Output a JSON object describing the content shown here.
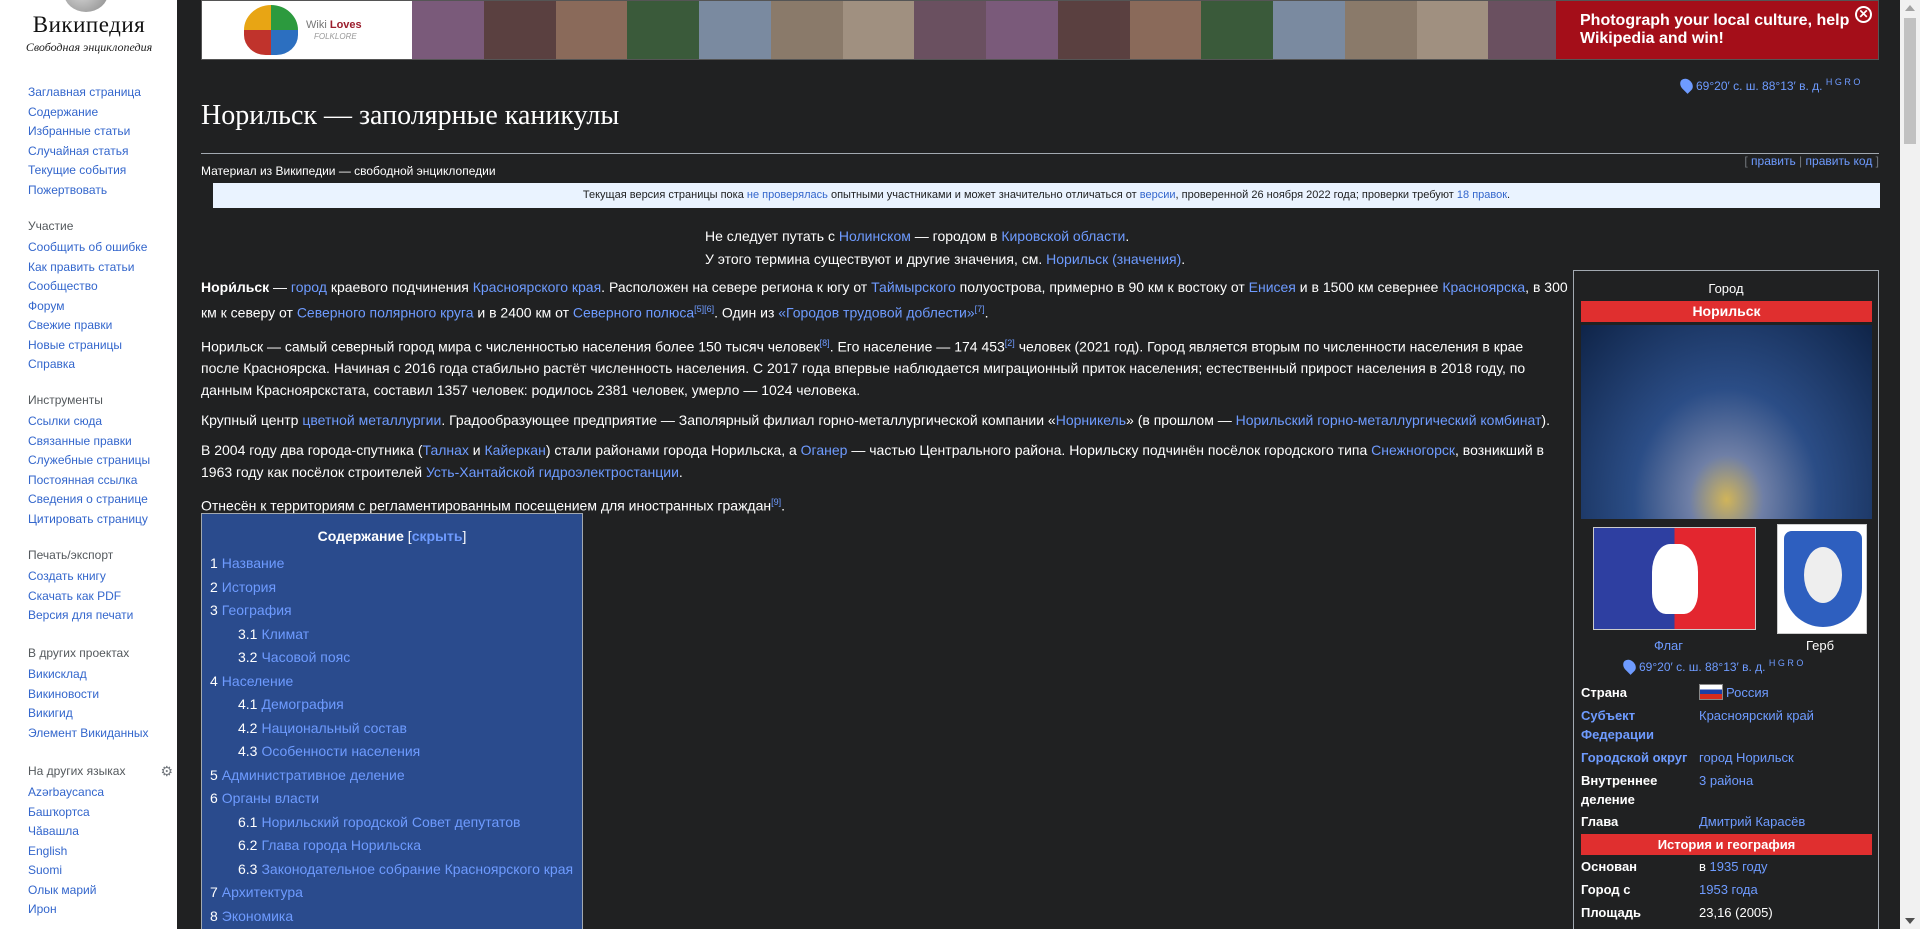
{
  "logo": {
    "wordmark": "Википедия",
    "tagline": "Свободная энциклопедия"
  },
  "sidebar": {
    "nav": [
      "Заглавная страница",
      "Содержание",
      "Избранные статьи",
      "Случайная статья",
      "Текущие события",
      "Пожертвовать"
    ],
    "participation": {
      "heading": "Участие",
      "items": [
        "Сообщить об ошибке",
        "Как править статьи",
        "Сообщество",
        "Форум",
        "Свежие правки",
        "Новые страницы",
        "Справка"
      ]
    },
    "tools": {
      "heading": "Инструменты",
      "items": [
        "Ссылки сюда",
        "Связанные правки",
        "Служебные страницы",
        "Постоянная ссылка",
        "Сведения о странице",
        "Цитировать страницу"
      ]
    },
    "print": {
      "heading": "Печать/экспорт",
      "items": [
        "Создать книгу",
        "Скачать как PDF",
        "Версия для печати"
      ]
    },
    "projects": {
      "heading": "В других проектах",
      "items": [
        "Викисклад",
        "Викиновости",
        "Викигид",
        "Элемент Викиданных"
      ]
    },
    "languages": {
      "heading": "На других языках",
      "items": [
        "Azərbaycanca",
        "Башҡортса",
        "Чӑвашла",
        "English",
        "Suomi",
        "Олык марий",
        "Ирон"
      ]
    }
  },
  "banner": {
    "brand_small": "Wiki",
    "brand_loves": "Loves",
    "brand_folklore": "FOLKLORE",
    "promo_text": "Photograph your local culture, help Wikipedia and win!",
    "close_glyph": "✕",
    "strip_colors": [
      "#7a5a7a",
      "#5a4040",
      "#8a6a5a",
      "#3a5a3a",
      "#7a8aa0",
      "#8a7a6a",
      "#a09080",
      "#6a5060",
      "#7a5a7a",
      "#5a4040",
      "#8a6a5a",
      "#3a5a3a",
      "#7a8aa0",
      "#8a7a6a",
      "#a09080",
      "#6a5060"
    ]
  },
  "coords": {
    "text": "69°20′ с. ш. 88°13′ в. д.",
    "letters": "H G R O"
  },
  "page": {
    "title": "Норильск — заполярные каникулы",
    "from": "Материал из Википедии — свободной энциклопедии",
    "edit": "править",
    "edit_code": "править код",
    "flagged": {
      "t1": "Текущая версия страницы пока ",
      "l1": "не проверялась",
      "t2": " опытными участниками и может значительно отличаться от ",
      "l2": "версии",
      "t3": ", проверенной 26 ноября 2022 года; проверки требуют ",
      "l3": "18 правок",
      "t4": "."
    },
    "hat1": {
      "t1": "Не следует путать с ",
      "l1": "Нолинском",
      "t2": " — городом в ",
      "l2": "Кировской области",
      "t3": "."
    },
    "hat2": {
      "t1": "У этого термина существуют и другие значения, см. ",
      "l1": "Норильск (значения)",
      "t2": "."
    }
  },
  "paras": {
    "p1": {
      "b": "Нори́льск",
      "t1": " — ",
      "l1": "город",
      "t2": " краевого подчинения ",
      "l2": "Красноярского края",
      "t3": ". Расположен на севере региона к югу от ",
      "l3": "Таймырского",
      "t4": " полуострова, примерно в 90 км к востоку от ",
      "l4": "Енисея",
      "t5": " и в 1500 км севернее ",
      "l5": "Красноярска",
      "t6": ", в 300 км к северу от ",
      "l6": "Северного полярного круга",
      "t7": " и в 2400 км от ",
      "l7": "Северного полюса",
      "s1": "[5][6]",
      "t8": ". Один из ",
      "l8": "«Городов трудовой доблести»",
      "s2": "[7]",
      "t9": "."
    },
    "p2": {
      "t1": "Норильск — самый северный город мира с численностью населения более 150 тысяч человек",
      "s1": "[8]",
      "t2": ". Его население — 174 453",
      "s2": "[2]",
      "t3": " человек (2021 год). Город является вторым по численности населения в крае после Красноярска. Начиная с 2016 года стабильно растёт численность населения. С 2017 года впервые наблюдается миграционный приток населения; естественный прирост населения в 2018 году, по данным Красноярскстата, составил 1357 человек: родилось 2381 человек, умерло — 1024 человека."
    },
    "p3": {
      "t1": "Крупный центр ",
      "l1": "цветной металлургии",
      "t2": ". Градообразующее предприятие — Заполярный филиал горно-металлургической компании «",
      "l2": "Норникель",
      "t3": "» (в прошлом — ",
      "l3": "Норильский горно-металлургический комбинат",
      "t4": ")."
    },
    "p4": {
      "t1": "В 2004 году два города-спутника (",
      "l1": "Талнах",
      "t2": " и ",
      "l2": "Кайеркан",
      "t3": ") стали районами города Норильска, а ",
      "l3": "Оганер",
      "t4": " — частью Центрального района. Норильску подчинён посёлок городского типа ",
      "l4": "Снежногорск",
      "t5": ", возникший в 1963 году как посёлок строителей ",
      "l5": "Усть-Хантайской гидроэлектростанции",
      "t6": "."
    },
    "p5": {
      "t1": "Отнесён к территориям с регламентированным посещением для иностранных граждан",
      "s1": "[9]",
      "t2": "."
    }
  },
  "toc": {
    "title": "Содержание",
    "toggle_open": "[",
    "toggle": "скрыть",
    "toggle_close": "]",
    "items": [
      {
        "num": "1",
        "label": "Название"
      },
      {
        "num": "2",
        "label": "История"
      },
      {
        "num": "3",
        "label": "География"
      },
      {
        "num": "3.1",
        "label": "Климат"
      },
      {
        "num": "3.2",
        "label": "Часовой пояс"
      },
      {
        "num": "4",
        "label": "Население"
      },
      {
        "num": "4.1",
        "label": "Демография"
      },
      {
        "num": "4.2",
        "label": "Национальный состав"
      },
      {
        "num": "4.3",
        "label": "Особенности населения"
      },
      {
        "num": "5",
        "label": "Административное деление"
      },
      {
        "num": "6",
        "label": "Органы власти"
      },
      {
        "num": "6.1",
        "label": "Норильский городской Совет депутатов"
      },
      {
        "num": "6.2",
        "label": "Глава города Норильска"
      },
      {
        "num": "6.3",
        "label": "Законодательное собрание Красноярского края"
      },
      {
        "num": "7",
        "label": "Архитектура"
      },
      {
        "num": "8",
        "label": "Экономика"
      }
    ]
  },
  "infobox": {
    "kind": "Город",
    "name": "Норильск",
    "flag_caption": "Флаг",
    "coa_caption": "Герб",
    "rows": [
      {
        "k": "Страна",
        "v": "Россия"
      },
      {
        "k": "Субъект Федерации",
        "v": "Красноярский край"
      },
      {
        "k": "Городской округ",
        "v": "город Норильск"
      },
      {
        "k": "Внутреннее деление",
        "v": "3 района"
      },
      {
        "k": "Глава",
        "v": "Дмитрий Карасёв"
      }
    ],
    "section": "История и география",
    "rows2": [
      {
        "k": "Основан",
        "v_pre": "в ",
        "v": "1935 году"
      },
      {
        "k": "Город с",
        "v_pre": "",
        "v": "1953 года"
      },
      {
        "k": "Площадь",
        "v_pre": "",
        "v": "23,16 (2005)"
      }
    ]
  }
}
